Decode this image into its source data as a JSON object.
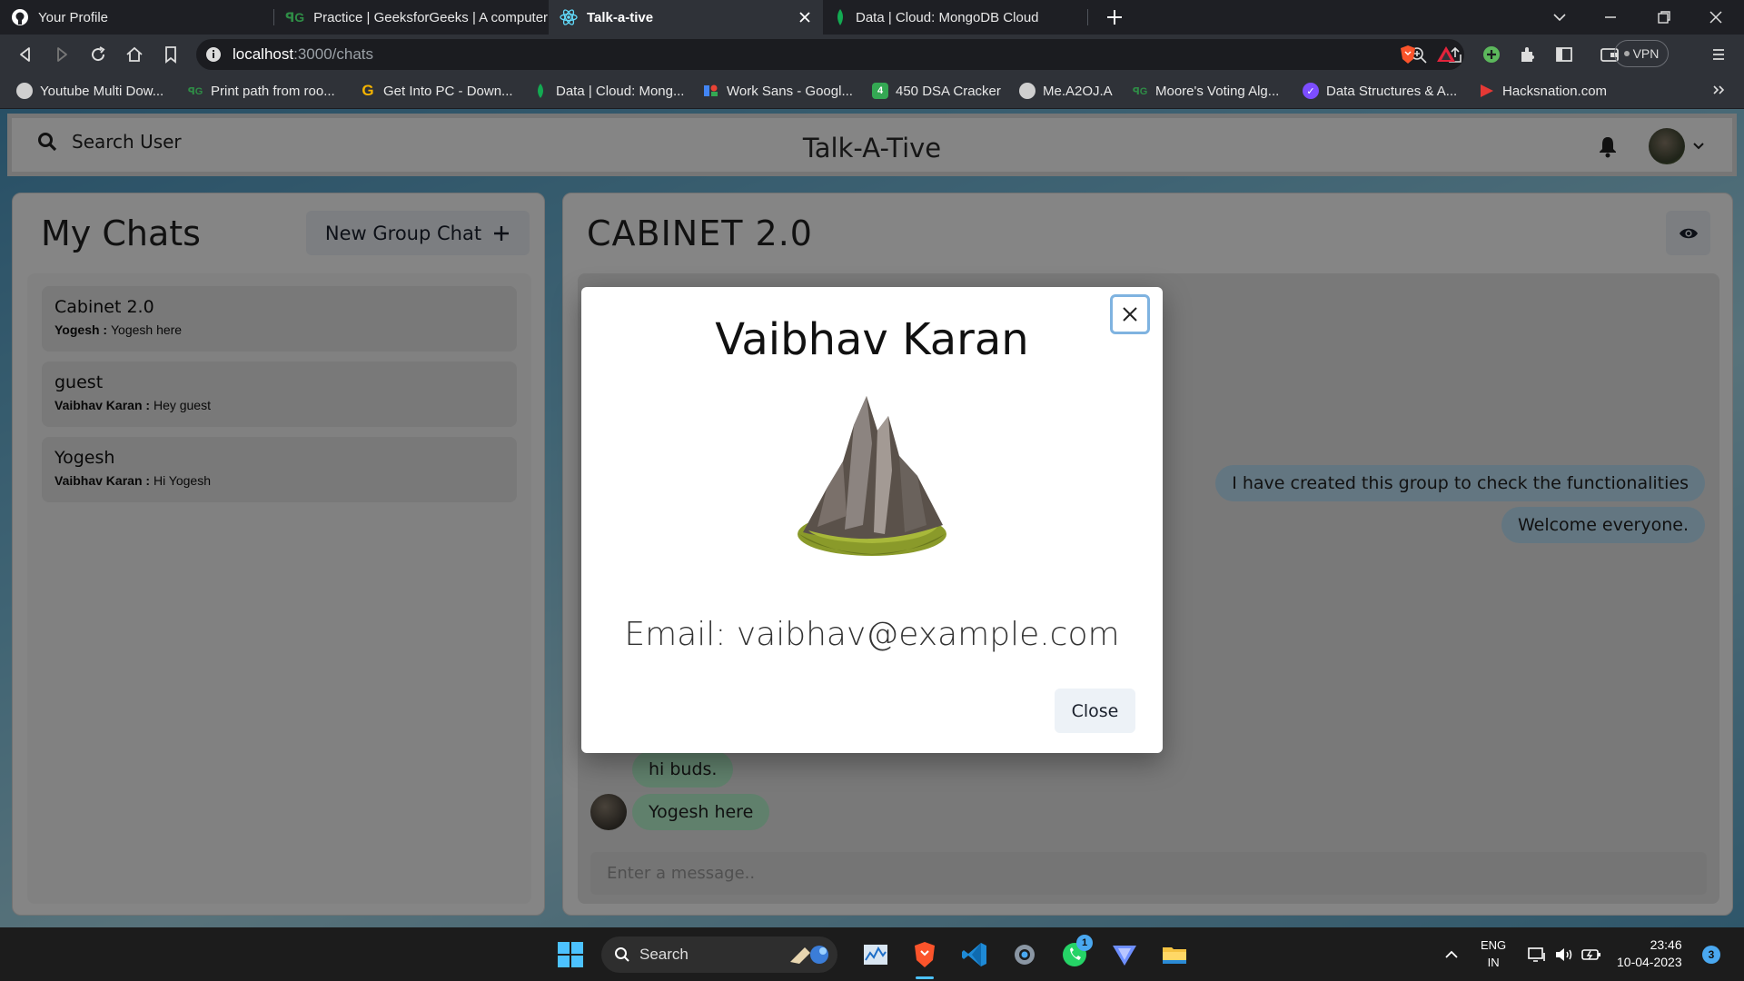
{
  "browser": {
    "tabs": [
      {
        "title": "Your Profile",
        "icon": "github-icon"
      },
      {
        "title": "Practice | GeeksforGeeks | A computer",
        "icon": "geeksforgeeks-icon"
      },
      {
        "title": "Talk-a-tive",
        "icon": "react-icon",
        "active": true
      },
      {
        "title": "Data | Cloud: MongoDB Cloud",
        "icon": "mongodb-icon"
      }
    ],
    "url_host": "localhost",
    "url_path": ":3000/chats",
    "vpn_label": "VPN",
    "bookmarks": [
      {
        "label": "Youtube Multi Dow...",
        "icon_color": "#cfcfcf"
      },
      {
        "label": "Print path from roo...",
        "icon_color": "#2f8d46"
      },
      {
        "label": "Get Into PC - Down...",
        "icon_color": "#f5b400"
      },
      {
        "label": "Data | Cloud: Mong...",
        "icon_color": "#13aa52"
      },
      {
        "label": "Work Sans - Googl...",
        "icon_color": "#4285f4"
      },
      {
        "label": "450 DSA Cracker",
        "icon_color": "#34a853"
      },
      {
        "label": "Me.A2OJ.A",
        "icon_color": "#cfcfcf"
      },
      {
        "label": "Moore's Voting Alg...",
        "icon_color": "#2f8d46"
      },
      {
        "label": "Data Structures & A...",
        "icon_color": "#7c4dff"
      },
      {
        "label": "Hacksnation.com",
        "icon_color": "#e53935"
      }
    ],
    "bookmark_450_glyph": "4",
    "get_into_pc_glyph": "G"
  },
  "app": {
    "search_label": "Search User",
    "title": "Talk-A-Tive",
    "my_chats_title": "My Chats",
    "new_group_label": "New Group Chat",
    "chats": [
      {
        "name": "Cabinet 2.0",
        "sender": "Yogesh",
        "message": "Yogesh here"
      },
      {
        "name": "guest",
        "sender": "Vaibhav Karan",
        "message": "Hey guest"
      },
      {
        "name": "Yogesh",
        "sender": "Vaibhav Karan",
        "message": "Hi Yogesh"
      }
    ],
    "chat_title": "CABINET 2.0",
    "messages": [
      {
        "text": "I have created this group to check the functionalities",
        "mine": true
      },
      {
        "text": "Welcome everyone.",
        "mine": true
      },
      {
        "text": "hi buds.",
        "mine": false
      },
      {
        "text": "Yogesh here",
        "mine": false
      }
    ],
    "message_placeholder": "Enter a message.."
  },
  "modal": {
    "name": "Vaibhav Karan",
    "email_text": "Email: vaibhav@example.com",
    "close_label": "Close"
  },
  "taskbar": {
    "search_label": "Search",
    "lang_line1": "ENG",
    "lang_line2": "IN",
    "time": "23:46",
    "date": "10-04-2023",
    "notification_count": "3",
    "whatsapp_badge": "1"
  },
  "colors": {
    "my_bubble": "#bee3f8",
    "their_bubble": "#b9f5d0",
    "button_bg": "#edf2f7"
  }
}
